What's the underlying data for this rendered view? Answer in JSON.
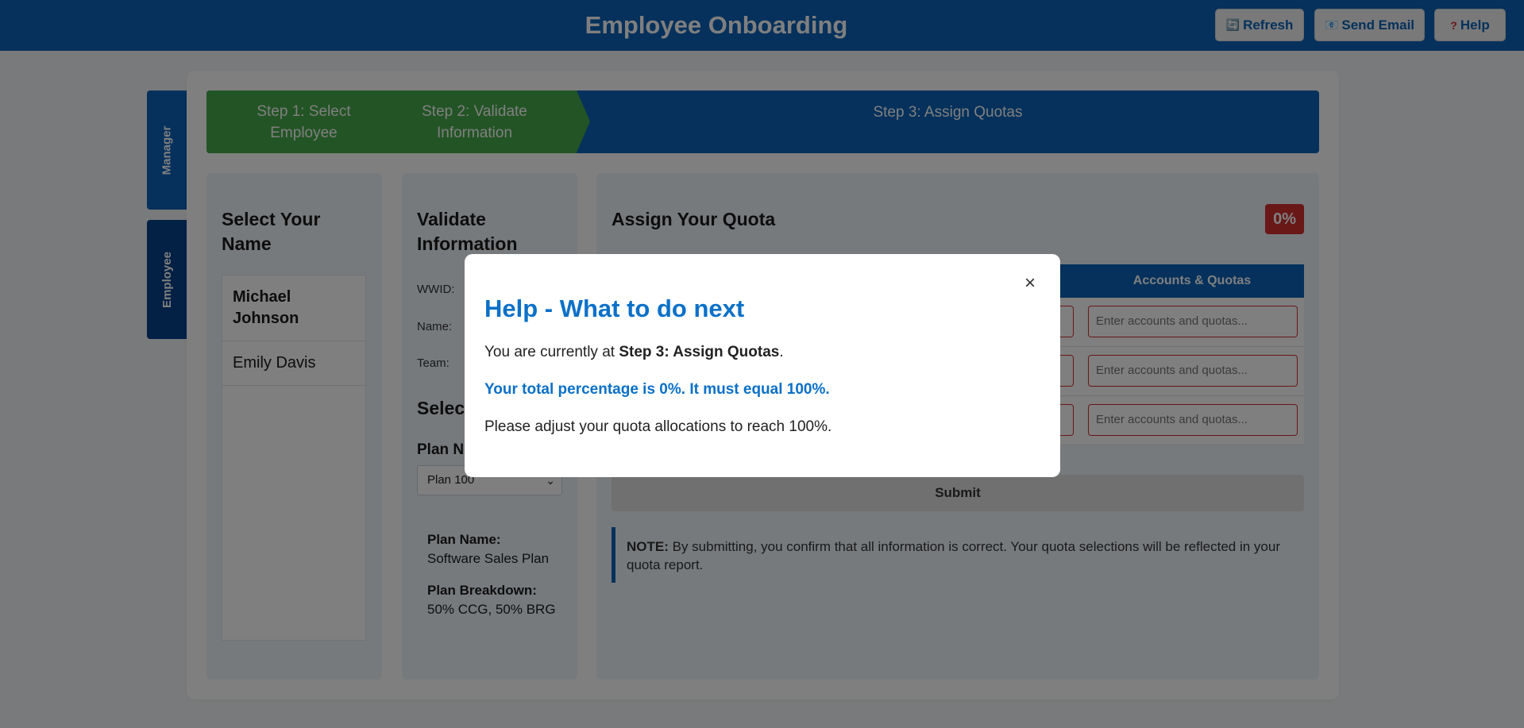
{
  "header": {
    "title": "Employee Onboarding",
    "refresh_label": "Refresh",
    "email_label": "Send Email",
    "help_label": "Help",
    "refresh_icon": "refresh-icon",
    "email_icon": "mail-icon",
    "help_icon": "question-icon"
  },
  "side_tabs": {
    "manager": "Manager",
    "employee": "Employee"
  },
  "steps": [
    {
      "label": "Step 1: Select Employee"
    },
    {
      "label": "Step 2: Validate Information"
    },
    {
      "label": "Step 3: Assign Quotas"
    }
  ],
  "select_name": {
    "heading": "Select Your Name",
    "names": [
      "Michael Johnson",
      "Emily Davis"
    ]
  },
  "validate": {
    "heading": "Validate Information",
    "wwid_label": "WWID:",
    "name_label": "Name:",
    "team_label": "Team:",
    "select_heading": "Select",
    "plan_label": "Plan N",
    "plan_value": "Plan 100",
    "plan_name_label": "Plan Name:",
    "plan_name_value": "Software Sales Plan",
    "breakdown_label": "Plan Breakdown:",
    "breakdown_value": "50% CCG, 50% BRG"
  },
  "quota": {
    "heading": "Assign Your Quota",
    "total_pct": "0%",
    "column_header": "Accounts & Quotas",
    "placeholder": "Enter accounts and quotas...",
    "submit_label": "Submit",
    "note_label": "NOTE:",
    "note_text": "By submitting, you confirm that all information is correct. Your quota selections will be reflected in your quota report."
  },
  "modal": {
    "title": "Help - What to do next",
    "close_label": "×",
    "line1_prefix": "You are currently at ",
    "line1_step": "Step 3: Assign Quotas",
    "line1_suffix": ".",
    "warning": "Your total percentage is 0%. It must equal 100%.",
    "line3": "Please adjust your quota allocations to reach 100%."
  },
  "colors": {
    "primary": "#0a63b8",
    "done_step": "#47a84b",
    "error": "#d32f2f"
  }
}
